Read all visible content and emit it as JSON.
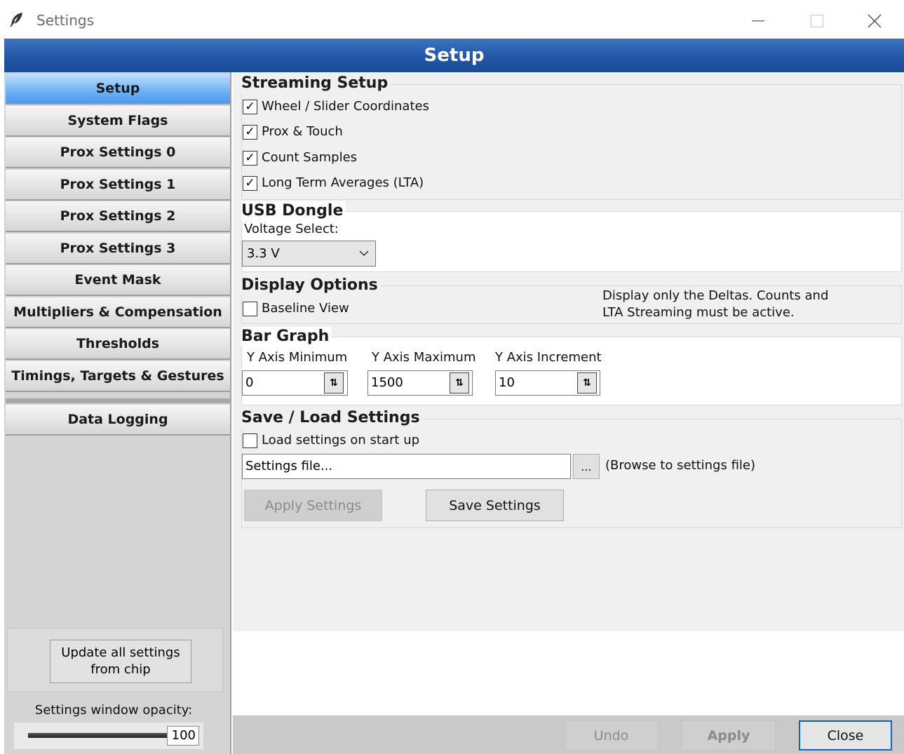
{
  "window": {
    "title": "Settings"
  },
  "header": {
    "title": "Setup"
  },
  "sidebar": {
    "items": [
      {
        "label": "Setup",
        "active": true
      },
      {
        "label": "System Flags"
      },
      {
        "label": "Prox Settings 0"
      },
      {
        "label": "Prox Settings 1"
      },
      {
        "label": "Prox Settings 2"
      },
      {
        "label": "Prox Settings 3"
      },
      {
        "label": "Event Mask"
      },
      {
        "label": "Multipliers & Compensation"
      },
      {
        "label": "Thresholds"
      },
      {
        "label": "Timings, Targets & Gestures"
      },
      {
        "label": "Data Logging"
      }
    ],
    "update_button": {
      "line1": "Update all settings",
      "line2": "from chip"
    },
    "opacity_label": "Settings window opacity:",
    "opacity_value": "100"
  },
  "streaming": {
    "title": "Streaming Setup",
    "options": [
      {
        "label": "Wheel / Slider Coordinates",
        "checked": true
      },
      {
        "label": "Prox & Touch",
        "checked": true
      },
      {
        "label": "Count Samples",
        "checked": true
      },
      {
        "label": "Long Term Averages (LTA)",
        "checked": true
      }
    ]
  },
  "usb": {
    "title": "USB Dongle",
    "voltage_label": "Voltage Select:",
    "voltage_value": "3.3 V"
  },
  "display": {
    "title": "Display Options",
    "baseline_label": "Baseline View",
    "baseline_checked": false,
    "note_line1": "Display only the Deltas. Counts and",
    "note_line2": "LTA Streaming must be active."
  },
  "bargraph": {
    "title": "Bar Graph",
    "ymin_label": "Y Axis Minimum",
    "ymin_value": "0",
    "ymax_label": "Y Axis Maximum",
    "ymax_value": "1500",
    "yinc_label": "Y Axis Increment",
    "yinc_value": "10"
  },
  "saveload": {
    "title": "Save / Load Settings",
    "load_on_startup_label": "Load settings on start up",
    "load_on_startup_checked": false,
    "file_value": "Settings file...",
    "browse_label": "...",
    "browse_hint": "(Browse to settings file)",
    "apply_settings_label": "Apply Settings",
    "save_settings_label": "Save Settings"
  },
  "footer": {
    "undo_label": "Undo",
    "apply_label": "Apply",
    "close_label": "Close"
  },
  "colors": {
    "header": "#2257a6",
    "active_nav": "#6fb2f5",
    "close_border": "#0a64d8"
  }
}
